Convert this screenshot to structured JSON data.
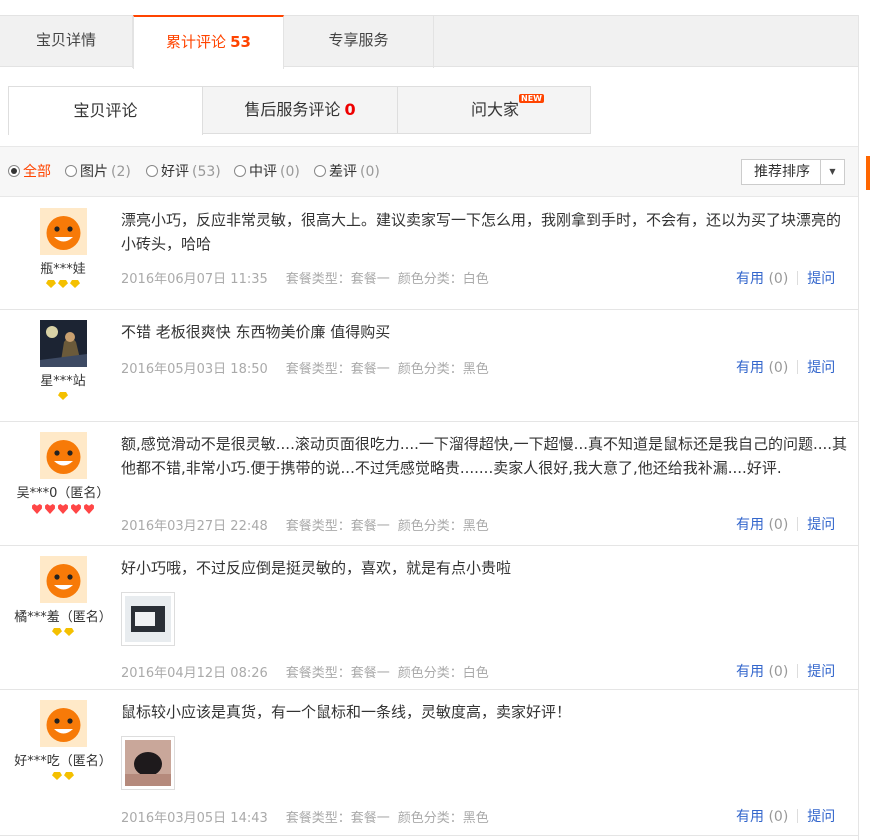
{
  "top_tabs": {
    "details": "宝贝详情",
    "reviews": "累计评论",
    "reviews_count": "53",
    "service": "专享服务"
  },
  "sub_tabs": {
    "item_reviews": "宝贝评论",
    "after_sale": "售后服务评论",
    "after_sale_count": "0",
    "ask": "问大家",
    "new_badge": "NEW"
  },
  "filters": {
    "all": "全部",
    "pictures": "图片",
    "pictures_count": "(2)",
    "good": "好评",
    "good_count": "(53)",
    "medium": "中评",
    "medium_count": "(0)",
    "bad": "差评",
    "bad_count": "(0)",
    "sort": "推荐排序",
    "selected": "all"
  },
  "labels": {
    "useful": "有用",
    "ask": "提问"
  },
  "reviews": [
    {
      "user": "瓶***娃",
      "content": "漂亮小巧，反应非常灵敏，很高大上。建议卖家写一下怎么用，我刚拿到手时，不会有，还以为买了块漂亮的小砖头，哈哈",
      "date": "2016年06月07日 11:35",
      "package": "套餐类型：套餐一",
      "color": "颜色分类：白色",
      "useful_count": "(0)",
      "badge_type": "diamond",
      "badges": 3
    },
    {
      "user": "星***站",
      "content": "不错 老板很爽快 东西物美价廉 值得购买",
      "date": "2016年05月03日 18:50",
      "package": "套餐类型：套餐一",
      "color": "颜色分类：黑色",
      "useful_count": "(0)",
      "badge_type": "diamond",
      "badges": 1
    },
    {
      "user": "吴***0（匿名）",
      "content": "额,感觉滑动不是很灵敏....滚动页面很吃力....一下溜得超快,一下超慢...真不知道是鼠标还是我自己的问题....其他都不错,非常小巧.便于携带的说...不过凭感觉略贵.......卖家人很好,我大意了,他还给我补漏....好评.",
      "date": "2016年03月27日 22:48",
      "package": "套餐类型：套餐一",
      "color": "颜色分类：黑色",
      "useful_count": "(0)",
      "badge_type": "heart",
      "badges": 5
    },
    {
      "user": "橘***羞（匿名）",
      "content": "好小巧哦，不过反应倒是挺灵敏的，喜欢，就是有点小贵啦",
      "date": "2016年04月12日 08:26",
      "package": "套餐类型：套餐一",
      "color": "颜色分类：白色",
      "useful_count": "(0)",
      "badge_type": "diamond",
      "badges": 2
    },
    {
      "user": "好***吃（匿名）",
      "content": "鼠标较小应该是真货，有一个鼠标和一条线，灵敏度高，卖家好评！",
      "date": "2016年03月05日 14:43",
      "package": "套餐类型：套餐一",
      "color": "颜色分类：黑色",
      "useful_count": "(0)",
      "badge_type": "diamond",
      "badges": 2
    }
  ],
  "colors": {
    "accent": "#ff4400",
    "link": "#3366cc",
    "meta": "#aaaaaa"
  }
}
